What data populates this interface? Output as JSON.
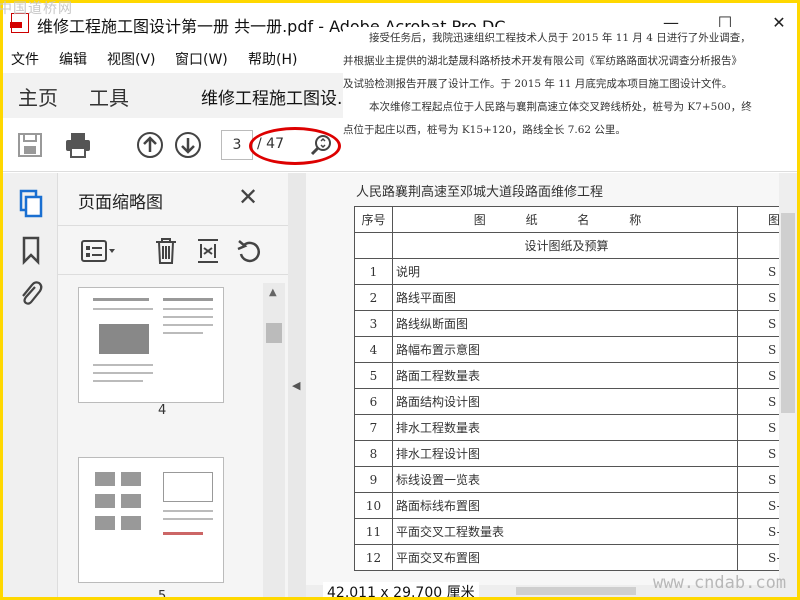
{
  "watermark_top": "中国道桥网",
  "watermark_bottom": "www.cndab.com",
  "window": {
    "title": "维修工程施工图设计第一册 共一册.pdf - Adobe Acrobat Pro DC",
    "minimize": "—",
    "maximize": "☐",
    "close": "✕"
  },
  "menu": [
    "文件",
    "编辑",
    "视图(V)",
    "窗口(W)",
    "帮助(H)"
  ],
  "tabs": {
    "home": "主页",
    "tools": "工具",
    "document": "维修工程施工图设..."
  },
  "toolbar": {
    "current_page": "3",
    "total_pages": "/ 47"
  },
  "overlay_text": [
    "接受任务后，我院迅速组织工程技术人员于 2015 年 11 月 4 日进行了外业调查，",
    "并根据业主提供的湖北楚晟科路桥技术开发有限公司《军纺路路面状况调查分析报告》",
    "及试验检测报告开展了设计工作。于 2015 年 11 月底完成本项目施工图设计文件。",
    "本次维修工程起点位于人民路与襄荆高速立体交叉跨线桥处，桩号为 K7+500，终",
    "点位于起庄以西，桩号为 K15+120，路线全长 7.62 公里。"
  ],
  "thumbnails": {
    "title": "页面缩略图",
    "close": "✕",
    "pages": [
      "4",
      "5"
    ]
  },
  "document": {
    "header": "人民路襄荆高速至邓城大道段路面维修工程",
    "table": {
      "col_no": "序号",
      "col_name": "图 纸 名 称",
      "col_code": "图",
      "section": "设计图纸及预算",
      "rows": [
        {
          "no": "1",
          "name": "说明",
          "code": "S"
        },
        {
          "no": "2",
          "name": "路线平面图",
          "code": "S"
        },
        {
          "no": "3",
          "name": "路线纵断面图",
          "code": "S"
        },
        {
          "no": "4",
          "name": "路幅布置示意图",
          "code": "S"
        },
        {
          "no": "5",
          "name": "路面工程数量表",
          "code": "S"
        },
        {
          "no": "6",
          "name": "路面结构设计图",
          "code": "S"
        },
        {
          "no": "7",
          "name": "排水工程数量表",
          "code": "S"
        },
        {
          "no": "8",
          "name": "排水工程设计图",
          "code": "S"
        },
        {
          "no": "9",
          "name": "标线设置一览表",
          "code": "S"
        },
        {
          "no": "10",
          "name": "路面标线布置图",
          "code": "S-"
        },
        {
          "no": "11",
          "name": "平面交叉工程数量表",
          "code": "S-"
        },
        {
          "no": "12",
          "name": "平面交叉布置图",
          "code": "S-"
        }
      ]
    }
  },
  "status": {
    "page_size": "42.011 x 29.700 厘米"
  },
  "accent": "#d00000"
}
